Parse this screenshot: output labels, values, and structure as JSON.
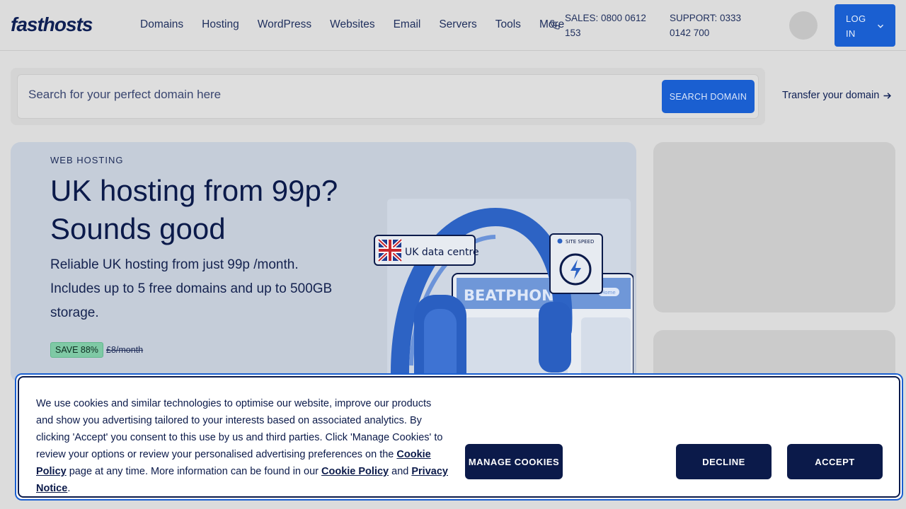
{
  "header": {
    "logo": "fasthosts",
    "nav": [
      "Domains",
      "Hosting",
      "WordPress",
      "Websites",
      "Email",
      "Servers",
      "Tools",
      "More"
    ],
    "sales": "SALES: 0800 0612 153",
    "support": "SUPPORT: 0333 0142 700",
    "login_label": "LOG IN"
  },
  "search": {
    "placeholder": "Search for your perfect domain here",
    "button": "SEARCH DOMAIN",
    "transfer": "Transfer your domain"
  },
  "hero": {
    "eyebrow": "WEB HOSTING",
    "title": "UK hosting from 99p? Sounds good",
    "description": "Reliable UK hosting from just 99p /month. Includes up to 5 free domains and up to 500GB storage.",
    "badge": "SAVE 88%",
    "old_price": "£8/month",
    "illustration": {
      "tag_uk": "UK data centre",
      "tag_speed": "SITE SPEED",
      "site_name": "BEATPHONE",
      "site_nav": "Home"
    }
  },
  "cookie": {
    "text_1": "We use cookies and similar technologies to optimise our website, improve our products and show you advertising tailored to your interests based on associated analytics. By clicking 'Accept' you consent to this use by us and third parties. Click 'Manage Cookies' to review your options or review your personalised advertising preferences on the ",
    "link_policy": "Cookie Policy",
    "text_2": " page at any time. More information can be found in our ",
    "link_policy_2": "Cookie Policy",
    "text_3": " and ",
    "link_privacy": "Privacy Notice",
    "text_4": ".",
    "manage": "MANAGE COOKIES",
    "decline": "DECLINE",
    "accept": "ACCEPT"
  },
  "colors": {
    "brand_blue": "#1a5fd1",
    "navy": "#0b1a4a",
    "save_green": "#7fc9a5"
  }
}
